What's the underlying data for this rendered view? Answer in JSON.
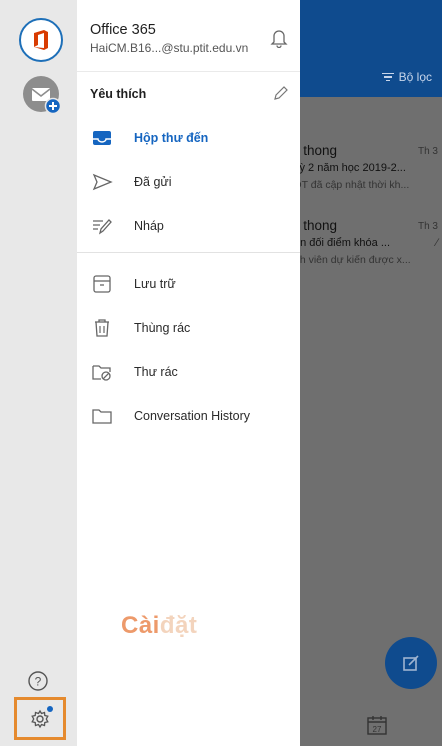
{
  "account": {
    "name": "Office 365",
    "email": "HaiCM.B16...@stu.ptit.edu.vn"
  },
  "favorites": {
    "title": "Yêu thích"
  },
  "folders": [
    {
      "label": "Hộp thư đến",
      "icon": "inbox-icon",
      "active": true
    },
    {
      "label": "Đã gửi",
      "icon": "send-icon",
      "active": false
    },
    {
      "label": "Nháp",
      "icon": "draft-icon",
      "active": false
    },
    {
      "label": "Lưu trữ",
      "icon": "archive-icon",
      "active": false
    },
    {
      "label": "Thùng rác",
      "icon": "trash-icon",
      "active": false
    },
    {
      "label": "Thư rác",
      "icon": "junk-icon",
      "active": false
    },
    {
      "label": "Conversation History",
      "icon": "folder-icon",
      "active": false
    }
  ],
  "overlay_caption": {
    "main": "Cài",
    "faded": "đặt"
  },
  "background": {
    "filter_label": "Bộ lọc",
    "emails": [
      {
        "from": "n thong",
        "date": "Th 3",
        "subject": "kỳ 2 năm học 2019-2...",
        "preview": "ĐT đã cập nhật thời kh..."
      },
      {
        "from": "n thong",
        "date": "Th 3",
        "subject": "ến đối điểm khóa ...",
        "preview": "nh viên dự kiến được x..."
      }
    ],
    "calendar_day": "27"
  },
  "colors": {
    "brand": "#0f4b8e",
    "active_folder": "#1565c0",
    "highlight_box": "#e58a2e",
    "office_logo": "#d83b01"
  }
}
